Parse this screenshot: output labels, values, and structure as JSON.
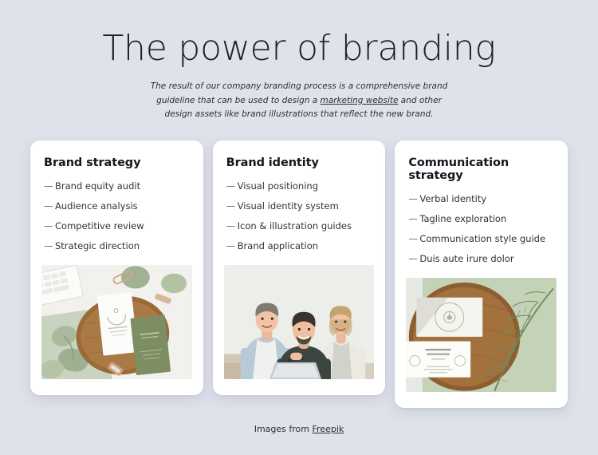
{
  "hero": {
    "title": "The power of branding",
    "subtitle_part1": "The result of our company branding process is a comprehensive brand guideline that can be used to design a ",
    "subtitle_link": "marketing website",
    "subtitle_part2": " and other design assets like brand illustrations that reflect the new brand."
  },
  "cards": [
    {
      "title": "Brand strategy",
      "marker": "—",
      "items": [
        "Brand equity audit",
        "Audience analysis",
        "Competitive review",
        "Strategic direction"
      ],
      "image_name": "branding-stationery-on-wooden-board-photo"
    },
    {
      "title": "Brand identity",
      "marker": "—",
      "items": [
        "Visual positioning",
        "Visual identity system",
        "Icon & illustration guides",
        "Brand application"
      ],
      "image_name": "three-men-smiling-at-laptop-photo"
    },
    {
      "title": "Communication strategy",
      "marker": "—",
      "items": [
        "Verbal identity",
        "Tagline exploration",
        "Communication style guide",
        "Duis aute irure dolor"
      ],
      "image_name": "business-cards-with-fern-photo"
    }
  ],
  "credit": {
    "text": "Images from ",
    "link": "Freepik"
  },
  "colors": {
    "page_background": "#dfe2eb",
    "card_background": "#ffffff",
    "heading": "#1d2125",
    "body_text": "#2e3339"
  }
}
